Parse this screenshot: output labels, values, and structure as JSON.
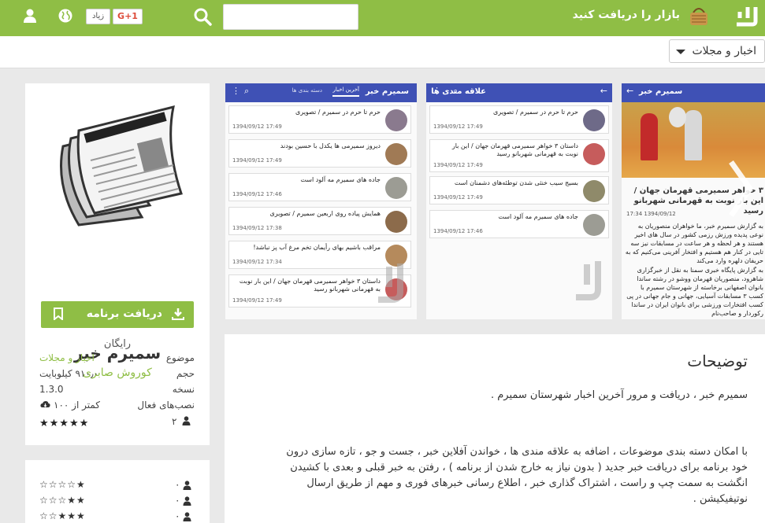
{
  "header": {
    "get_label": "بازار را دریافت کنید",
    "gplus_label": "G+1",
    "gplus_count": "زیاد",
    "search_value": "",
    "brand_color": "#8fbe45"
  },
  "subbar": {
    "category_selected": "اخبار و مجلات"
  },
  "app": {
    "name": "سمیرم خبر",
    "developer": "کوروش صابری",
    "install_label": "دریافت برنامه",
    "price": "رایگان",
    "details": [
      {
        "key": "موضوع",
        "value": "اخبار و مجلات"
      },
      {
        "key": "حجم",
        "value": "۹۱۰٫۰ کیلوبایت"
      },
      {
        "key": "نسخه",
        "value": "1.3.0"
      },
      {
        "key": "نصب‌های فعال",
        "value": "کمتر از ۱۰۰"
      }
    ],
    "rating_stars": 5,
    "rating_count": "۲"
  },
  "ratings": [
    {
      "stars": 1,
      "count": "۰"
    },
    {
      "stars": 2,
      "count": "۰"
    },
    {
      "stars": 3,
      "count": "۰"
    }
  ],
  "screenshots": {
    "shot1_title": "سمیرم خبر",
    "shot1_tabs": [
      "آخرین اخبار",
      "دسته بندی ها"
    ],
    "shot1_items": [
      {
        "title": "حرم تا حرم در سمیرم / تصویری",
        "date": "17:49 1394/09/12"
      },
      {
        "title": "دیروز سمیرمی ها یکدل با حسین بودند",
        "date": "17:49 1394/09/12"
      },
      {
        "title": "جاده های سمیرم مه آلود است",
        "date": "17:46 1394/09/12"
      },
      {
        "title": "همایش پیاده روی اربعین سمیرم / تصویری",
        "date": "17:38 1394/09/12"
      },
      {
        "title": "مراقب باشیم بهای رأیمان تخم مرغ آب پز نباشد!",
        "date": "17:34 1394/09/12"
      },
      {
        "title": "داستان ۳ خواهر سمیرمی قهرمان جهان / این بار نوبت به قهرمانی شهربانو رسید",
        "date": "17:49 1394/09/12"
      }
    ],
    "shot2_title": "علاقه مندی ها",
    "shot2_items": [
      {
        "title": "حرم تا حرم در سمیرم / تصویری",
        "date": "17:49 1394/09/12"
      },
      {
        "title": "داستان ۳ خواهر سمیرمی قهرمان جهان / این بار نوبت به قهرمانی شهربانو رسید",
        "date": "17:49 1394/09/12"
      },
      {
        "title": "بسیج سیب خنثی شدن توطئه‌های دشمنان است",
        "date": "17:49 1394/09/12"
      },
      {
        "title": "جاده های سمیرم مه آلود است",
        "date": "17:46 1394/09/12"
      }
    ],
    "shot3_title": "سمیرم خبر",
    "shot3_headline": "۳ خواهر سمیرمی قهرمان جهان / این بار نوبت به قهرمانی شهربانو رسید",
    "shot3_date": "17:34 1394/09/12",
    "shot3_body": "به گزارش سمیرم خبر، ما خواهران منصوریان به نوعی پدیده ورزش رزمی کشور در سال های اخیر هستند و هر لحظه و هر ساعت در مسابقات نیز سه تایی در کنار هم هستیم و افتخار آفرینی می‌کنیم که به حریفان دلهره وارد می‌کند",
    "shot3_body2": "به گزارش پایگاه خبری سمنا به نقل از خبرگزاری شاهرود، منصوریان قهرمان ووشو در رشته ساندا بانوان اصفهانی برخاسته از شهرستان سمیرم با کسب ۳ مسابقات آسیایی، جهانی و جام جهانی در پی کسب افتخارات ورزشی برای بانوان ایران در ساندا رکوردار و صاحب‌نام"
  },
  "description": {
    "title": "توضیحات",
    "p1": "سمیرم خبر ، دریافت و مرور آخرین اخبار شهرستان سمیرم .",
    "p2": "با امکان دسته بندی موضوعات ، اضافه به علاقه مندی ها ، خواندن آفلاین خبر ، جست و جو ، تازه سازی درون خود برنامه برای دریافت خبر جدید ( بدون نیاز به خارج شدن از برنامه ) ، رفتن به خبر قبلی و بعدی با کشیدن انگشت به سمت چپ و راست ، اشتراک گذاری خبر ، اطلاع رسانی خبرهای فوری و مهم از طریق ارسال نوتیفیکیشن ."
  }
}
